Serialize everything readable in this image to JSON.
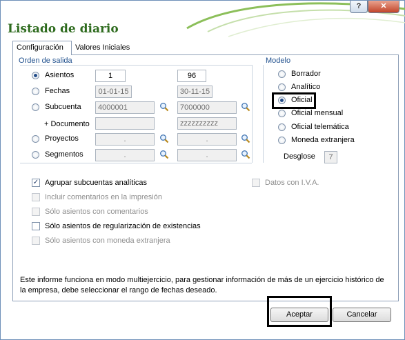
{
  "window": {
    "title": "Listado de diario",
    "help_label": "?",
    "close_label": "✕"
  },
  "tabs": [
    {
      "label": "Configuración",
      "active": true
    },
    {
      "label": "Valores Iniciales",
      "active": false
    }
  ],
  "orden": {
    "label": "Orden de salida",
    "rows": [
      {
        "label": "Asientos",
        "selected": true,
        "from": "1",
        "to": "96",
        "disabled": false
      },
      {
        "label": "Fechas",
        "selected": false,
        "from": "01-01-15",
        "to": "30-11-15",
        "disabled": true
      },
      {
        "label": "Subcuenta",
        "selected": false,
        "from": "4000001",
        "to": "7000000",
        "disabled": true
      },
      {
        "label": "+ Documento",
        "from": "",
        "to": "zzzzzzzzzz",
        "disabled": true
      },
      {
        "label": "Proyectos",
        "selected": false,
        "from": ".",
        "to": ".",
        "disabled": true
      },
      {
        "label": "Segmentos",
        "selected": false,
        "from": ".",
        "to": ".",
        "disabled": true
      }
    ]
  },
  "modelo": {
    "label": "Modelo",
    "options": [
      {
        "label": "Borrador",
        "selected": false
      },
      {
        "label": "Analítico",
        "selected": false
      },
      {
        "label": "Oficial",
        "selected": true
      },
      {
        "label": "Oficial mensual",
        "selected": false
      },
      {
        "label": "Oficial telemática",
        "selected": false
      },
      {
        "label": "Moneda extranjera",
        "selected": false
      }
    ],
    "desglose_label": "Desglose",
    "desglose_value": "7"
  },
  "options": [
    {
      "label": "Agrupar subcuentas analíticas",
      "checked": true,
      "disabled": false
    },
    {
      "label": "Incluir comentarios en la impresión",
      "checked": false,
      "disabled": true
    },
    {
      "label": "Sólo asientos con comentarios",
      "checked": false,
      "disabled": true
    },
    {
      "label": "Sólo asientos de regularización de existencias",
      "checked": false,
      "disabled": false
    },
    {
      "label": "Sólo asientos con moneda extranjera",
      "checked": false,
      "disabled": true
    }
  ],
  "datos_iva": {
    "label": "Datos con I.V.A.",
    "checked": false,
    "disabled": true
  },
  "info_text": "Este informe funciona en modo multiejercicio, para gestionar información de más de un ejercicio histórico de la empresa, debe seleccionar el rango de fechas deseado.",
  "buttons": {
    "accept": "Aceptar",
    "cancel": "Cancelar"
  },
  "colors": {
    "title": "#2e6b1e",
    "group_label": "#1d4e8c",
    "close": "#c2452a"
  }
}
